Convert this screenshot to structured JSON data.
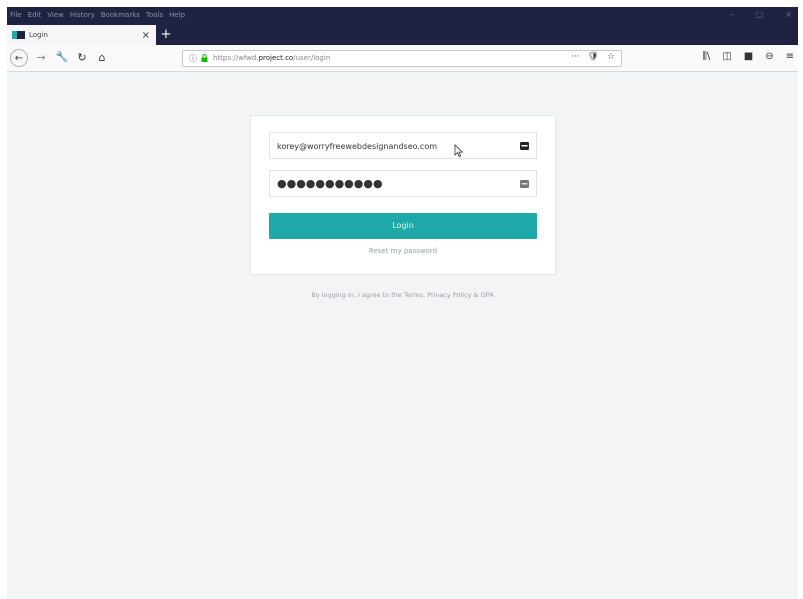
{
  "window": {
    "menus": [
      "File",
      "Edit",
      "View",
      "History",
      "Bookmarks",
      "Tools",
      "Help"
    ],
    "controls": [
      "–",
      "□",
      "×"
    ]
  },
  "tab": {
    "title": "Login",
    "close": "×",
    "new": "+"
  },
  "nav": {
    "back": "←",
    "forward": "→",
    "tools": "🔧",
    "reload": "↻",
    "home": "⌂",
    "url_info": "ⓘ",
    "url_prefix": "https://wfwd.",
    "url_domain": "project.co",
    "url_path": "/user/login",
    "url_more": "···",
    "pocket": "🛡",
    "bookmark": "☆",
    "library": "⫼\\",
    "sidebar": "◫",
    "extension": "■",
    "account": "⊖",
    "menu": "≡"
  },
  "login": {
    "email": "korey@worryfreewebdesignandseo.com",
    "password": "●●●●●●●●●●●",
    "button": "Login",
    "reset": "Reset my password"
  },
  "footer": {
    "terms": "By logging in, I agree to the Terms, Privacy Policy & DPA"
  },
  "colors": {
    "accent": "#1ea8a8",
    "titlebar": "#1f2240",
    "page_bg": "#f2f4f6"
  }
}
